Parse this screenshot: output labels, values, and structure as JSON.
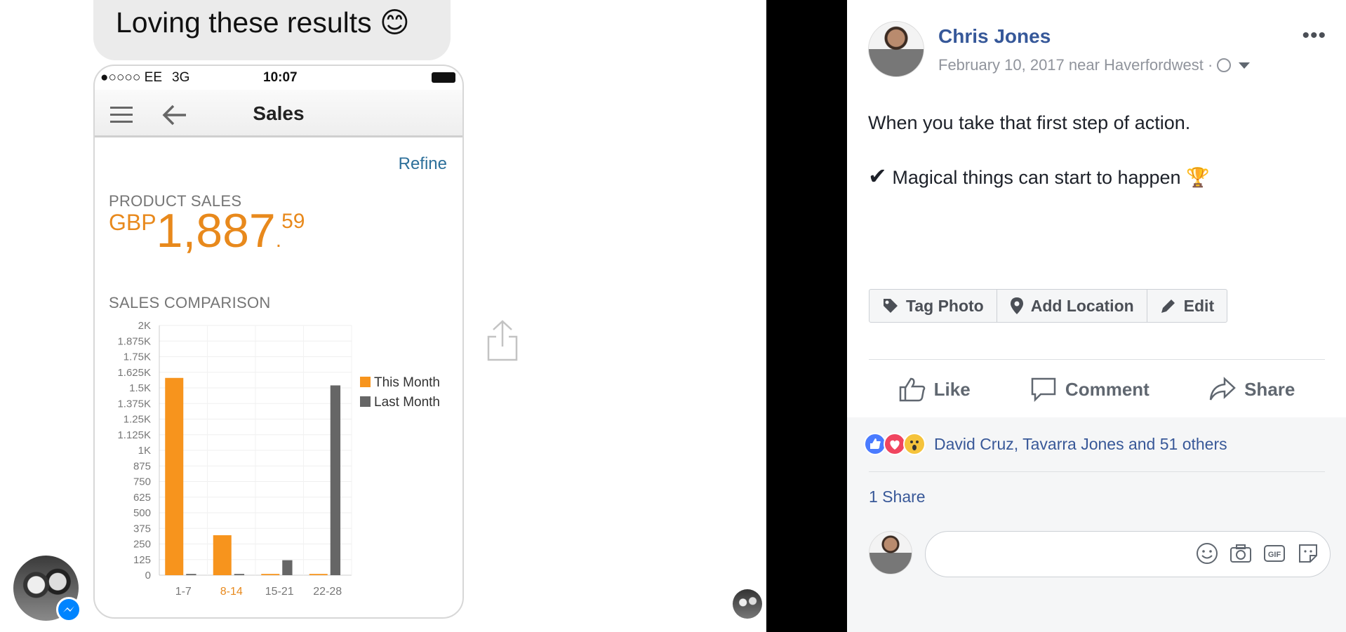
{
  "chat": {
    "message": "Loving these results 😊"
  },
  "phone": {
    "status": {
      "signal": "●○○○○ EE",
      "network": "3G",
      "time": "10:07"
    },
    "nav_title": "Sales",
    "refine_label": "Refine",
    "product_sales_caption": "PRODUCT SALES",
    "currency": "GBP",
    "amount_main": "1,887",
    "amount_dot": ".",
    "amount_cents": "59",
    "comparison_caption": "SALES COMPARISON"
  },
  "chart_data": {
    "type": "bar",
    "categories": [
      "1-7",
      "8-14",
      "15-21",
      "22-28"
    ],
    "series": [
      {
        "name": "This Month",
        "values": [
          1580,
          320,
          10,
          10
        ],
        "color": "#f7941d"
      },
      {
        "name": "Last Month",
        "values": [
          10,
          10,
          120,
          1520
        ],
        "color": "#666666"
      }
    ],
    "y_ticks": [
      "2K",
      "1.875K",
      "1.75K",
      "1.625K",
      "1.5K",
      "1.375K",
      "1.25K",
      "1.125K",
      "1K",
      "875",
      "750",
      "625",
      "500",
      "375",
      "250",
      "125",
      "0"
    ],
    "ylim": [
      0,
      2000
    ],
    "highlight_category": "8-14",
    "legend_position": "right",
    "grid": true
  },
  "post": {
    "author": "Chris Jones",
    "date_location": "February 10, 2017 near Haverfordwest ·",
    "more_label": "•••",
    "line1": "When you take that first step of action.",
    "check": "✔",
    "line2": "Magical things can start to happen 🏆",
    "photo_actions": {
      "tag": "Tag Photo",
      "location": "Add Location",
      "edit": "Edit"
    },
    "actions": {
      "like": "Like",
      "comment": "Comment",
      "share": "Share"
    },
    "reactions_text": "David Cruz, Tavarra Jones and 51 others",
    "shares_text": "1 Share",
    "colors": {
      "link": "#365899",
      "like_blue": "#4a7bff",
      "love_red": "#f0455f",
      "wow_yellow": "#f5c33b"
    }
  }
}
